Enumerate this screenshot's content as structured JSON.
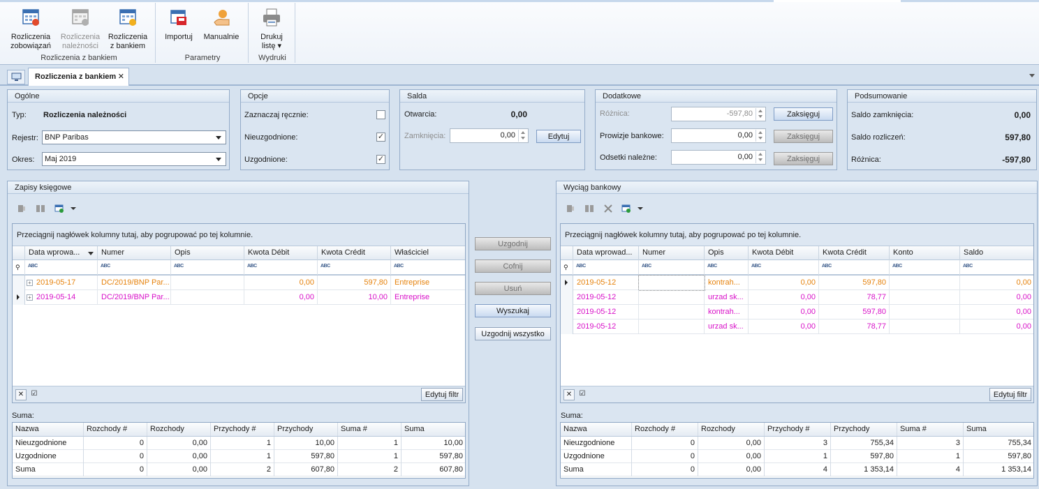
{
  "ribbon": {
    "groups": [
      {
        "label": "Rozliczenia z bankiem",
        "buttons": [
          {
            "line1": "Rozliczenia",
            "line2": "zobowiązań",
            "enabled": true
          },
          {
            "line1": "Rozliczenia",
            "line2": "należności",
            "enabled": false
          },
          {
            "line1": "Rozliczenia",
            "line2": "z bankiem",
            "enabled": true
          }
        ]
      },
      {
        "label": "Parametry",
        "buttons": [
          {
            "line1": "Importuj",
            "line2": "",
            "enabled": true
          },
          {
            "line1": "Manualnie",
            "line2": "",
            "enabled": true
          }
        ]
      },
      {
        "label": "Wydruki",
        "buttons": [
          {
            "line1": "Drukuj",
            "line2": "listę ▾",
            "enabled": true
          }
        ]
      }
    ]
  },
  "tab": {
    "label": "Rozliczenia z bankiem",
    "close": "✕"
  },
  "ogolne": {
    "title": "Ogólne",
    "typ_label": "Typ:",
    "typ_value": "Rozliczenia należności",
    "rejestr_label": "Rejestr:",
    "rejestr_value": "BNP Paribas",
    "okres_label": "Okres:",
    "okres_value": "Maj 2019"
  },
  "opcje": {
    "title": "Opcje",
    "items": [
      {
        "label": "Zaznaczaj ręcznie:",
        "checked": ""
      },
      {
        "label": "Nieuzgodnione:",
        "checked": "✓"
      },
      {
        "label": "Uzgodnione:",
        "checked": "✓"
      }
    ]
  },
  "salda": {
    "title": "Salda",
    "otwarcia_label": "Otwarcia:",
    "otwarcia_value": "0,00",
    "zamkniecia_label": "Zamknięcia:",
    "zamkniecia_value": "0,00",
    "edytuj": "Edytuj"
  },
  "dodatkowe": {
    "title": "Dodatkowe",
    "rows": [
      {
        "label": "Różnica:",
        "value": "-597,80",
        "button": "Zaksięguj"
      },
      {
        "label": "Prowizje bankowe:",
        "value": "0,00",
        "button": "Zaksięguj"
      },
      {
        "label": "Odsetki należne:",
        "value": "0,00",
        "button": "Zaksięguj"
      }
    ]
  },
  "podsumowanie": {
    "title": "Podsumowanie",
    "rows": [
      {
        "label": "Saldo zamknięcia:",
        "value": "0,00"
      },
      {
        "label": "Saldo rozliczeń:",
        "value": "597,80"
      },
      {
        "label": "Różnica:",
        "value": "-597,80"
      }
    ]
  },
  "zapisy": {
    "title": "Zapisy księgowe",
    "group_hint": "Przeciągnij nagłówek kolumny tutaj, aby pogrupować po tej kolumnie.",
    "columns": [
      "Data wprowa...",
      "Numer",
      "Opis",
      "Kwota Débit",
      "Kwota Crédit",
      "Właściciel"
    ],
    "rows": [
      {
        "cells": [
          "2019-05-17",
          "DC/2019/BNP Par...",
          "",
          "0,00",
          "597,80",
          "Entreprise"
        ],
        "color": "orange"
      },
      {
        "cells": [
          "2019-05-14",
          "DC/2019/BNP Par...",
          "",
          "0,00",
          "10,00",
          "Entreprise"
        ],
        "color": "pink"
      }
    ],
    "edit_filter": "Edytuj filtr"
  },
  "wyciag": {
    "title": "Wyciąg bankowy",
    "group_hint": "Przeciągnij nagłówek kolumny tutaj, aby pogrupować po tej kolumnie.",
    "columns": [
      "Data wprowad...",
      "Numer",
      "Opis",
      "Kwota Débit",
      "Kwota Crédit",
      "Konto",
      "Saldo"
    ],
    "rows": [
      {
        "cells": [
          "2019-05-12",
          "",
          "kontrah...",
          "0,00",
          "597,80",
          "",
          "0,00"
        ],
        "color": "orange"
      },
      {
        "cells": [
          "2019-05-12",
          "",
          "urzad sk...",
          "0,00",
          "78,77",
          "",
          "0,00"
        ],
        "color": "pink"
      },
      {
        "cells": [
          "2019-05-12",
          "",
          "kontrah...",
          "0,00",
          "597,80",
          "",
          "0,00"
        ],
        "color": "pink"
      },
      {
        "cells": [
          "2019-05-12",
          "",
          "urzad sk...",
          "0,00",
          "78,77",
          "",
          "0,00"
        ],
        "color": "pink"
      }
    ],
    "edit_filter": "Edytuj filtr"
  },
  "middle_buttons": [
    {
      "label": "Uzgodnij",
      "style": "dis"
    },
    {
      "label": "Cofnij",
      "style": "dis"
    },
    {
      "label": "Usuń",
      "style": "dis"
    },
    {
      "label": "Wyszukaj",
      "style": "hl"
    },
    {
      "label": "Uzgodnij wszystko",
      "style": ""
    }
  ],
  "suma_label": "Suma:",
  "sum_columns": [
    "Nazwa",
    "Rozchody #",
    "Rozchody",
    "Przychody #",
    "Przychody",
    "Suma #",
    "Suma"
  ],
  "sum_left": [
    [
      "Nieuzgodnione",
      "0",
      "0,00",
      "1",
      "10,00",
      "1",
      "10,00"
    ],
    [
      "Uzgodnione",
      "0",
      "0,00",
      "1",
      "597,80",
      "1",
      "597,80"
    ],
    [
      "Suma",
      "0",
      "0,00",
      "2",
      "607,80",
      "2",
      "607,80"
    ]
  ],
  "sum_right": [
    [
      "Nieuzgodnione",
      "0",
      "0,00",
      "3",
      "755,34",
      "3",
      "755,34"
    ],
    [
      "Uzgodnione",
      "0",
      "0,00",
      "1",
      "597,80",
      "1",
      "597,80"
    ],
    [
      "Suma",
      "0",
      "0,00",
      "4",
      "1 353,14",
      "4",
      "1 353,14"
    ]
  ]
}
